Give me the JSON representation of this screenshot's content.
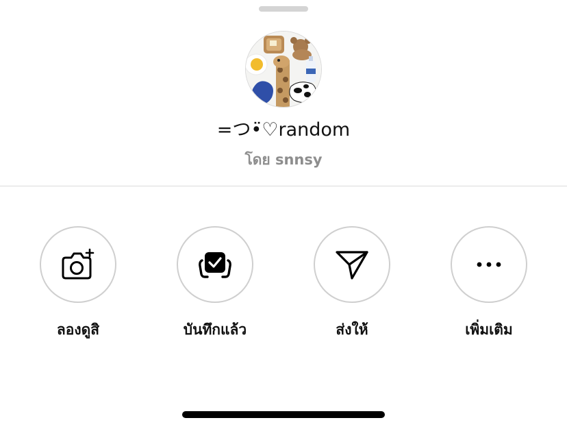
{
  "collection": {
    "title": "=つ•̈♡random",
    "owner_line": "โดย snnsy"
  },
  "actions": [
    {
      "label": "ลองดูสิ",
      "icon": "camera-plus-icon"
    },
    {
      "label": "บันทึกแล้ว",
      "icon": "saved-check-icon"
    },
    {
      "label": "ส่งให้",
      "icon": "send-icon"
    },
    {
      "label": "เพิ่มเติม",
      "icon": "more-dots-icon"
    }
  ],
  "colors": {
    "divider": "#dbdbdb",
    "circle_border": "#cfcfcf",
    "subtitle": "#8e8e8e",
    "grabber": "#d4d4d4"
  }
}
